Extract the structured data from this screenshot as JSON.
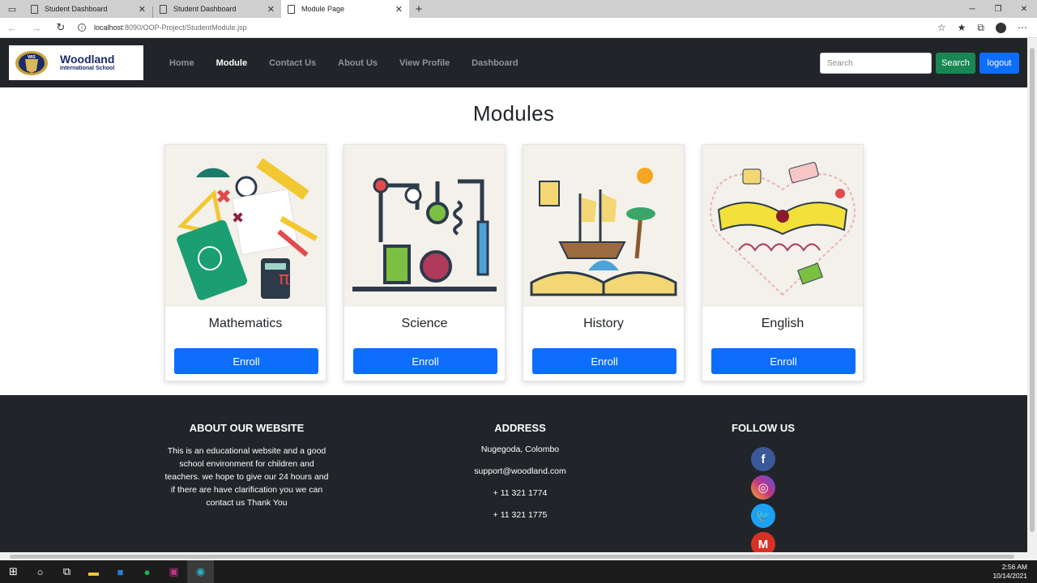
{
  "browser": {
    "tabs": [
      {
        "label": "Student Dashboard",
        "active": false
      },
      {
        "label": "Student Dashboard",
        "active": false
      },
      {
        "label": "Module Page",
        "active": true
      }
    ],
    "url_host": "localhost",
    "url_path": ":8090/OOP-Project/StudentModule.jsp"
  },
  "nav": {
    "logo_line1": "Woodland",
    "logo_line2": "International School",
    "crest_text": "WIS",
    "links": [
      {
        "label": "Home",
        "active": false
      },
      {
        "label": "Module",
        "active": true
      },
      {
        "label": "Contact Us",
        "active": false
      },
      {
        "label": "About Us",
        "active": false
      },
      {
        "label": "View Profile",
        "active": false
      },
      {
        "label": "Dashboard",
        "active": false
      }
    ],
    "search_placeholder": "Search",
    "search_button": "Search",
    "logout_button": "logout"
  },
  "main": {
    "title": "Modules",
    "modules": [
      {
        "name": "Mathematics",
        "button": "Enroll"
      },
      {
        "name": "Science",
        "button": "Enroll"
      },
      {
        "name": "History",
        "button": "Enroll"
      },
      {
        "name": "English",
        "button": "Enroll"
      }
    ]
  },
  "footer": {
    "about_title": "ABOUT OUR WEBSITE",
    "about_text": "This is an educational website and a good school environment for children and teachers. we hope to give our 24 hours and if there are have clarification you we can contact us Thank You",
    "address_title": "ADDRESS",
    "address_lines": [
      "Nugegoda, Colombo",
      "support@woodland.com",
      "+ 11 321 1774",
      "+ 11 321 1775"
    ],
    "follow_title": "FOLLOW US",
    "social": [
      {
        "icon": "facebook-icon",
        "color": "#3b5998"
      },
      {
        "icon": "instagram-icon",
        "color": "#c13584"
      },
      {
        "icon": "twitter-icon",
        "color": "#1da1f2"
      },
      {
        "icon": "gmail-icon",
        "color": "#d93025"
      }
    ]
  },
  "taskbar": {
    "time": "2:56 AM",
    "date": "10/14/2021"
  },
  "colors": {
    "navbar_bg": "#212529",
    "primary": "#0d6efd",
    "success": "#198754"
  }
}
